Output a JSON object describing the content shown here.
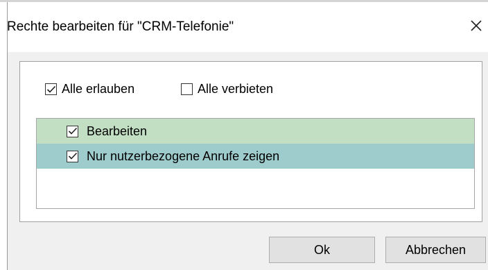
{
  "dialog": {
    "title": "Rechte bearbeiten für \"CRM-Telefonie\""
  },
  "options": {
    "allow_all": {
      "label": "Alle erlauben",
      "checked": true
    },
    "deny_all": {
      "label": "Alle verbieten",
      "checked": false
    }
  },
  "permissions": [
    {
      "label": "Bearbeiten",
      "checked": true,
      "row_color": "#c3dfc3"
    },
    {
      "label": "Nur nutzerbezogene Anrufe zeigen",
      "checked": true,
      "row_color": "#9ecccc"
    }
  ],
  "buttons": {
    "ok": "Ok",
    "cancel": "Abbrechen"
  },
  "icons": {
    "close": "close-icon",
    "check": "checkmark-icon"
  }
}
